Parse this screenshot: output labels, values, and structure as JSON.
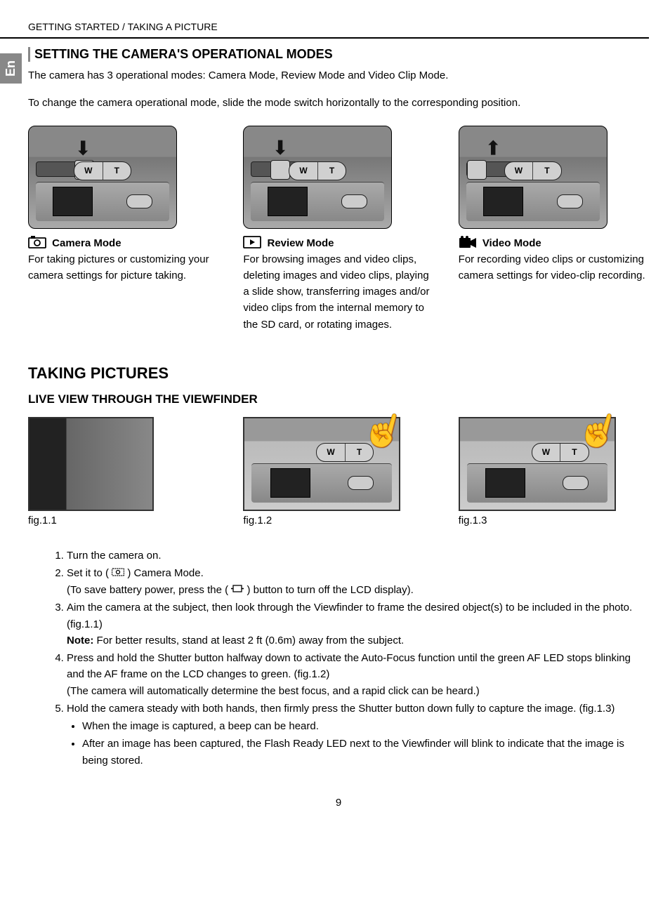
{
  "header": {
    "breadcrumb": "GETTING STARTED / TAKING A PICTURE"
  },
  "lang_tab": "En",
  "section1": {
    "heading": "SETTING THE CAMERA'S OPERATIONAL MODES",
    "intro1": "The camera has 3 operational modes: Camera Mode, Review Mode and Video Clip Mode.",
    "intro2": "To change the camera operational mode, slide the mode switch horizontally to the corresponding position."
  },
  "modes": [
    {
      "icon_name": "camera-icon",
      "title": "Camera Mode",
      "desc": "For taking pictures or customizing your camera settings for picture taking."
    },
    {
      "icon_name": "play-icon",
      "title": "Review Mode",
      "desc": "For browsing images and video clips, deleting images and video clips, playing a slide show, transferring images and/or video clips from the internal memory to the SD card, or rotating images."
    },
    {
      "icon_name": "video-icon",
      "title": "Video Mode",
      "desc": "For recording video clips or customizing camera settings for video-clip recording."
    }
  ],
  "section2": {
    "heading": "TAKING PICTURES",
    "subheading": "LIVE VIEW THROUGH THE VIEWFINDER",
    "figs": [
      "fig.1.1",
      "fig.1.2",
      "fig.1.3"
    ]
  },
  "steps": {
    "s1": "Turn the camera on.",
    "s2a": "Set it to ( ",
    "s2b": " ) Camera Mode.",
    "s2c": "(To save battery power, press the ( ",
    "s2d": " ) button to turn off the LCD display).",
    "s3a": "Aim the camera at the subject, then look through the Viewfinder to frame the desired object(s) to be included in the photo. (fig.1.1)",
    "s3note_label": "Note:",
    "s3note": " For better results, stand at least 2 ft (0.6m) away from the subject.",
    "s4a": "Press and hold the Shutter button halfway down to activate the Auto-Focus function until the green AF LED stops blinking and the AF frame on the LCD changes to green. (fig.1.2)",
    "s4b": "(The camera will automatically determine the best focus, and a rapid click can be heard.)",
    "s5a": "Hold the camera steady with both hands, then firmly press the Shutter button down fully to capture the image. (fig.1.3)",
    "s5b1": "When the image is captured, a beep can be heard.",
    "s5b2": "After an image has been captured, the Flash Ready LED next to the Viewfinder will blink to indicate that the image is being stored."
  },
  "page_number": "9",
  "icons": {
    "zoom_w": "W",
    "zoom_t": "T"
  }
}
